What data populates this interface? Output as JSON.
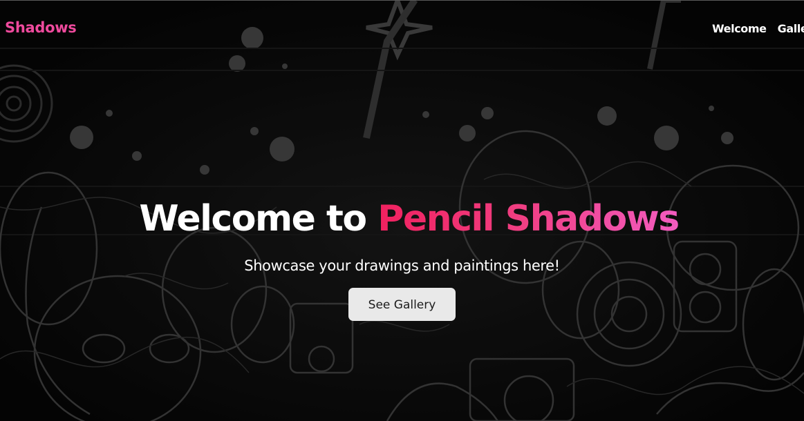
{
  "brand": {
    "text": "Shadows",
    "color": "#ef4a9d"
  },
  "nav": {
    "items": [
      {
        "label": "Welcome"
      },
      {
        "label": "Gallery"
      }
    ]
  },
  "hero": {
    "title_prefix": "Welcome to ",
    "title_accent": "Pencil Shadows",
    "subtitle": "Showcase your drawings and paintings here!",
    "cta_label": "See Gallery"
  },
  "colors": {
    "background": "#090909",
    "accent_start": "#f0215f",
    "accent_end": "#f25cc0",
    "button_bg": "#e9e9e9",
    "text": "#ffffff"
  }
}
